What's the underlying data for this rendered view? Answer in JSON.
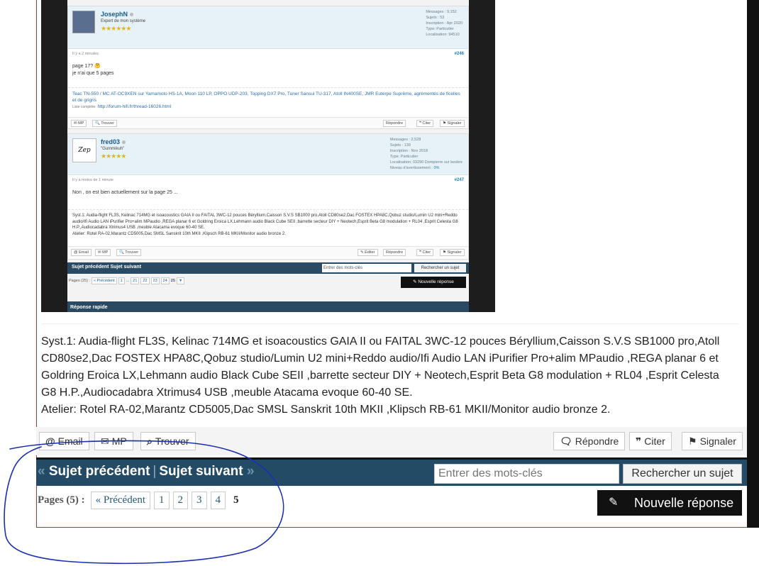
{
  "embedded": {
    "post1": {
      "username": "JosephN",
      "user_title": "Expert de mon système",
      "stars": "★★★★★★",
      "stats": [
        "Messages : 9,152",
        "Sujets : 53",
        "Inscription : Apr 2020",
        "Type: Particulier",
        "Localisation: 94510"
      ],
      "time": "Il y a 2 minutes",
      "number": "#246",
      "line1": "page 17? 🤔",
      "line2": "je n'ai que 5 pages",
      "sig": "Teac TN-550 / MC AT-OC9XEN sur Yamamoto HS-1A, Moon 110 LP, OPPO UDP-203, Topping DX7 Pro, Tuner Sansui TU-317, Atoll IN400SE, JMR Euterpe Suprême, agrémentés de ficelles et de grigris",
      "sig_list_label": "Liste complète:",
      "sig_link": "http://forum-hifi.fr/thread-16026.html",
      "btn_mp": "✉ MP",
      "btn_find": "🔍 Trouver",
      "btn_reply": "Répondre",
      "btn_quote": "❞ Citer",
      "btn_report": "⚑ Signaler"
    },
    "post2": {
      "username": "fred03",
      "avatar_text": "Zep",
      "user_title": "\"Gummikuh\"",
      "stars": "★★★★★",
      "stats": [
        "Messages : 2,528",
        "Sujets : 139",
        "Inscription : Nov 2018",
        "Type: Particulier",
        "Localisation: 03290 Dompierre sur besbre"
      ],
      "warn_label": "Niveau d'avertissement :",
      "warn_value": "0%",
      "time": "Il y a moins de 1 minute",
      "number": "#247",
      "body": "Non , on est bien actuellement sur la page 25 ...",
      "sig": "Syst.1: Audia-flight FL3S, Kelinac 714MG et isoacoustics GAIA II ou FAITAL 3WC-12 pouces Béryllium,Caisson S.V.S SB1000 pro,Atoll CD80se2,Dac FOSTEX HPA8C,Qobuz studio/Lumin U2 mini+Reddo audio/Ifi Audio LAN iPurifier Pro+alim MPaudio ,REGA planar 6 et Goldring Eroica LX,Lehmann audio Black Cube SEII ,barrette secteur DIY + Neotech,Esprit Beta G8 modulation + RL04 ,Esprit Celesta G8 H.P.,Audiocadabra Xtrimus4 USB ,meuble Atacama evoque 60-40 SE.",
      "sig2": "Atelier: Rotel RA-02,Marantz CD5005,Dac SMSL Sanskrit 10th MKII ,Klipsch RB-61 MKII/Monitor audio bronze 2.",
      "btn_email": "@ Email",
      "btn_mp": "✉ MP",
      "btn_find": "🔍 Trouver",
      "btn_edit": "✎ Éditer",
      "btn_reply": "Répondre",
      "btn_quote": "❞ Citer",
      "btn_report": "⚑ Signaler"
    },
    "nav": {
      "links": "Sujet précédent  Sujet suivant",
      "search_placeholder": "Entrer des mots-clés",
      "search_button": "Rechercher un sujet"
    },
    "pages": {
      "label": "Pages (25) :",
      "prev": "« Précédent",
      "p1": "1",
      "dots": "...",
      "p21": "21",
      "p22": "22",
      "p23": "23",
      "p24": "24",
      "current": "25"
    },
    "new_reply": "Nouvelle réponse",
    "quick_reply": "Réponse rapide"
  },
  "signature": {
    "line1": "Syst.1: Audia-flight FL3S, Kelinac 714MG et isoacoustics GAIA II ou FAITAL 3WC-12 pouces Béryllium,Caisson S.V.S SB1000 pro,Atoll CD80se2,Dac FOSTEX HPA8C,Qobuz studio/Lumin U2 mini+Reddo audio/Ifi Audio LAN iPurifier Pro+alim MPaudio ,REGA planar 6 et Goldring Eroica LX,Lehmann audio Black Cube SEII ,barrette secteur DIY + Neotech,Esprit Beta G8 modulation + RL04 ,Esprit Celesta G8 H.P.,Audiocadabra Xtrimus4 USB ,meuble Atacama evoque 60-40 SE.",
    "line2": "Atelier: Rotel RA-02,Marantz CD5005,Dac SMSL Sanskrit 10th MKII ,Klipsch RB-61 MKII/Monitor audio bronze 2."
  },
  "actions": {
    "email": "Email",
    "mp": "MP",
    "find": "Trouver",
    "reply": "Répondre",
    "quote": "Citer",
    "report": "Signaler"
  },
  "nav": {
    "prev_thread": "Sujet précédent",
    "separator": "|",
    "next_thread": "Sujet suivant",
    "search_placeholder": "Entrer des mots-clés",
    "search_button": "Rechercher un sujet"
  },
  "pagination": {
    "label": "Pages (5) :",
    "prev": "« Précédent",
    "pages": [
      "1",
      "2",
      "3",
      "4"
    ],
    "current": "5"
  },
  "new_reply": "Nouvelle réponse",
  "colors": {
    "nav_bar": "#244b66",
    "annotation": "#1a2fb0",
    "frame_border": "#c62828"
  },
  "icons": {
    "email": "at-icon",
    "mp": "envelope-icon",
    "find": "search-icon",
    "reply": "speech-bubble-icon",
    "quote": "quote-icon",
    "report": "flag-icon",
    "new_reply": "pencil-icon"
  }
}
